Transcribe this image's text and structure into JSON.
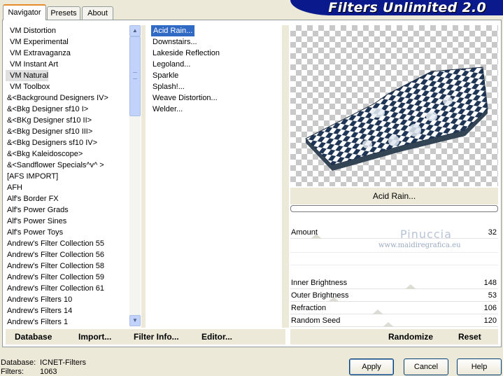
{
  "tabs": [
    {
      "label": "Navigator",
      "active": true
    },
    {
      "label": "Presets",
      "active": false
    },
    {
      "label": "About",
      "active": false
    }
  ],
  "banner_title": "Filters Unlimited 2.0",
  "categories": [
    "VM Distortion",
    "VM Experimental",
    "VM Extravaganza",
    "VM Instant Art",
    "VM Natural",
    "VM Toolbox",
    "&<Background Designers IV>",
    "&<Bkg Designer sf10 I>",
    "&<BKg Designer sf10 II>",
    "&<Bkg Designer sf10 III>",
    "&<Bkg Designers sf10 IV>",
    "&<Bkg Kaleidoscope>",
    "&<Sandflower Specials^v^ >",
    "[AFS IMPORT]",
    "AFH",
    "Alf's Border FX",
    "Alf's Power Grads",
    "Alf's Power Sines",
    "Alf's Power Toys",
    "Andrew's Filter Collection 55",
    "Andrew's Filter Collection 56",
    "Andrew's Filter Collection 58",
    "Andrew's Filter Collection 59",
    "Andrew's Filter Collection 61",
    "Andrew's Filters 10",
    "Andrew's Filters 14",
    "Andrew's Filters 1"
  ],
  "selected_category": "VM Natural",
  "filters": [
    "Acid Rain...",
    "Downstairs...",
    "Lakeside Reflection",
    "Legoland...",
    "Sparkle",
    "Splash!...",
    "Weave Distortion...",
    "Welder..."
  ],
  "selected_filter": "Acid Rain...",
  "current_filter_name": "Acid Rain...",
  "params": [
    {
      "label": "Amount",
      "value": "32",
      "level": 0.125
    },
    {
      "label": "Inner Brightness",
      "value": "148",
      "level": 0.58
    },
    {
      "label": "Outer Brightness",
      "value": "53",
      "level": 0.21
    },
    {
      "label": "Refraction",
      "value": "106",
      "level": 0.42
    },
    {
      "label": "Random Seed",
      "value": "120",
      "level": 0.47
    }
  ],
  "watermark": {
    "name": "Pinuccia",
    "url": "www.maidiregrafica.eu"
  },
  "toolbar": {
    "database": "Database",
    "import": "Import...",
    "filter_info": "Filter Info...",
    "editor": "Editor...",
    "randomize": "Randomize",
    "reset": "Reset"
  },
  "status": {
    "database_label": "Database:",
    "database_value": "ICNET-Filters",
    "filters_label": "Filters:",
    "filters_value": "1063"
  },
  "buttons": {
    "apply": "Apply",
    "cancel": "Cancel",
    "help": "Help"
  },
  "icons": {
    "scroll_up": "scroll-up-icon",
    "scroll_down": "scroll-down-icon"
  },
  "colors": {
    "banner": "#0a1a8c",
    "selection": "#316ac5",
    "tab_accent": "#e68b2c"
  }
}
